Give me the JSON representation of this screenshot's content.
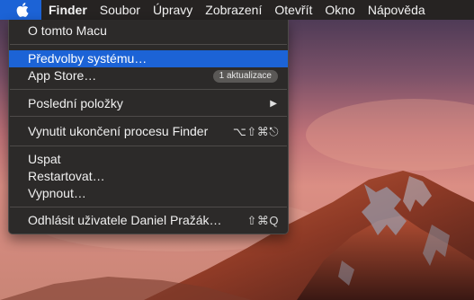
{
  "menubar": {
    "apple_icon": "apple-logo-icon",
    "items": [
      "Finder",
      "Soubor",
      "Úpravy",
      "Zobrazení",
      "Otevřít",
      "Okno",
      "Nápověda"
    ]
  },
  "apple_menu": {
    "about": "O tomto Macu",
    "system_preferences": "Předvolby systému…",
    "app_store": "App Store…",
    "app_store_badge": "1 aktualizace",
    "recent_items": "Poslední položky",
    "force_quit": "Vynutit ukončení procesu Finder",
    "force_quit_shortcut": "⌥⇧⌘⎋",
    "sleep": "Uspat",
    "restart": "Restartovat…",
    "shut_down": "Vypnout…",
    "log_out": "Odhlásit uživatele Daniel Pražák…",
    "log_out_shortcut": "⇧⌘Q"
  },
  "colors": {
    "highlight": "#1c63d6",
    "menubar": "#262322",
    "menu_background": "#2c2a29"
  }
}
